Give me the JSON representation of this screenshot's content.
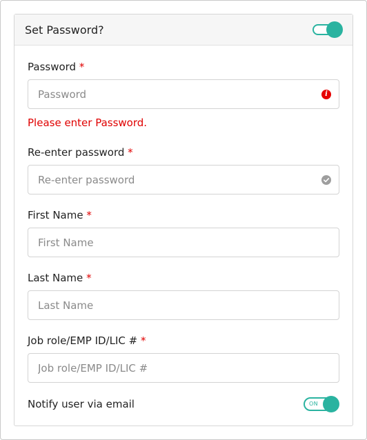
{
  "header": {
    "title": "Set Password?",
    "toggle_state": "on"
  },
  "fields": {
    "password": {
      "label": "Password",
      "required_mark": "*",
      "placeholder": "Password",
      "value": "",
      "status_icon": "error-info-icon",
      "error": "Please enter Password."
    },
    "reenter_password": {
      "label": "Re-enter password",
      "required_mark": "*",
      "placeholder": "Re-enter password",
      "value": "",
      "status_icon": "check-circle-icon"
    },
    "first_name": {
      "label": "First Name",
      "required_mark": "*",
      "placeholder": "First Name",
      "value": ""
    },
    "last_name": {
      "label": "Last Name",
      "required_mark": "*",
      "placeholder": "Last Name",
      "value": ""
    },
    "job_role": {
      "label": "Job role/EMP ID/LIC #",
      "required_mark": "*",
      "placeholder": "Job role/EMP ID/LIC #",
      "value": ""
    }
  },
  "notify": {
    "label": "Notify user via email",
    "toggle_text": "ON"
  },
  "colors": {
    "accent": "#2ab3a0",
    "error": "#e00000",
    "border": "#d3d3d3",
    "header_bg": "#f6f6f6"
  }
}
